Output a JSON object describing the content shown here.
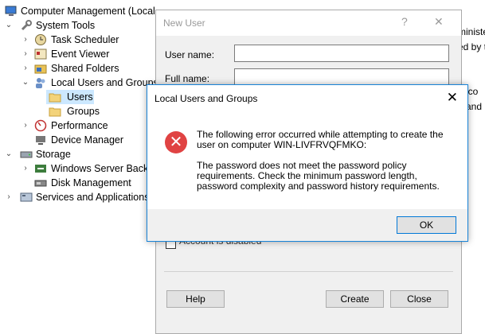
{
  "tree": {
    "root": "Computer Management (Local",
    "system_tools": "System Tools",
    "task_scheduler": "Task Scheduler",
    "event_viewer": "Event Viewer",
    "shared_folders": "Shared Folders",
    "local_users_groups": "Local Users and Groups",
    "users": "Users",
    "groups": "Groups",
    "performance": "Performance",
    "device_manager": "Device Manager",
    "storage": "Storage",
    "wsb": "Windows Server Backup",
    "disk_mgmt": "Disk Management",
    "services_apps": "Services and Applications"
  },
  "right_pane": {
    "line1": "ministe",
    "line2": "ed by th",
    "line3": "acco",
    "line4": "and"
  },
  "new_user": {
    "title": "New User",
    "help_glyph": "?",
    "close_glyph": "✕",
    "user_name_label": "User name:",
    "full_name_label": "Full name:",
    "account_disabled_label": "Account is disabled",
    "help_button": "Help",
    "create_button": "Create",
    "close_button": "Close"
  },
  "error": {
    "title": "Local Users and Groups",
    "close_glyph": "✕",
    "icon_glyph": "✕",
    "line1": "The following error occurred while attempting to create the",
    "line2": "user    on computer WIN-LIVFRVQFMKO:",
    "line3": "The password does not meet the password policy",
    "line4": "requirements. Check the minimum password length,",
    "line5": "password complexity and password history requirements.",
    "ok_button": "OK"
  }
}
